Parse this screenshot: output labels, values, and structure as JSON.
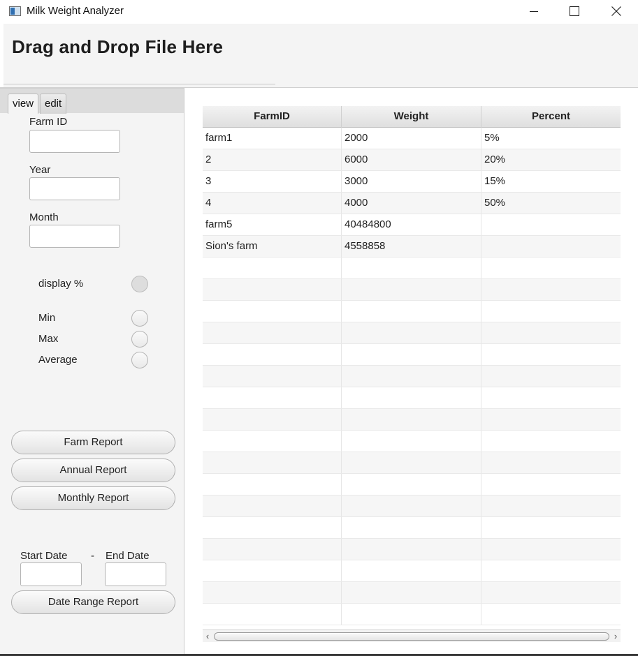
{
  "window": {
    "title": "Milk Weight Analyzer"
  },
  "header": {
    "title": "Drag and Drop File Here"
  },
  "tabs": [
    {
      "label": "view",
      "selected": true
    },
    {
      "label": "edit",
      "selected": false
    }
  ],
  "filters": {
    "farm_id_label": "Farm ID",
    "farm_id_value": "",
    "year_label": "Year",
    "year_value": "",
    "month_label": "Month",
    "month_value": ""
  },
  "options": {
    "display_percent_label": "display %",
    "display_percent_selected": false,
    "min_label": "Min",
    "min_selected": false,
    "max_label": "Max",
    "max_selected": false,
    "average_label": "Average",
    "average_selected": false
  },
  "reports": {
    "farm_report": "Farm Report",
    "annual_report": "Annual Report",
    "monthly_report": "Monthly Report",
    "date_range_report": "Date Range Report"
  },
  "date_range": {
    "start_label": "Start Date",
    "separator": "-",
    "end_label": "End Date",
    "start_value": "",
    "end_value": ""
  },
  "table": {
    "columns": [
      "FarmID",
      "Weight",
      "Percent"
    ],
    "rows": [
      [
        "farm1",
        "2000",
        "5%"
      ],
      [
        "2",
        "6000",
        "20%"
      ],
      [
        "3",
        "3000",
        "15%"
      ],
      [
        "4",
        "4000",
        "50%"
      ],
      [
        "farm5",
        "40484800",
        ""
      ],
      [
        "Sion's farm",
        "4558858",
        ""
      ],
      [
        "",
        "",
        ""
      ],
      [
        "",
        "",
        ""
      ],
      [
        "",
        "",
        ""
      ],
      [
        "",
        "",
        ""
      ],
      [
        "",
        "",
        ""
      ],
      [
        "",
        "",
        ""
      ],
      [
        "",
        "",
        ""
      ],
      [
        "",
        "",
        ""
      ],
      [
        "",
        "",
        ""
      ],
      [
        "",
        "",
        ""
      ],
      [
        "",
        "",
        ""
      ],
      [
        "",
        "",
        ""
      ],
      [
        "",
        "",
        ""
      ],
      [
        "",
        "",
        ""
      ],
      [
        "",
        "",
        ""
      ],
      [
        "",
        "",
        ""
      ],
      [
        "",
        "",
        ""
      ]
    ]
  },
  "scrollbar": {
    "left_arrow": "‹",
    "right_arrow": "›"
  }
}
